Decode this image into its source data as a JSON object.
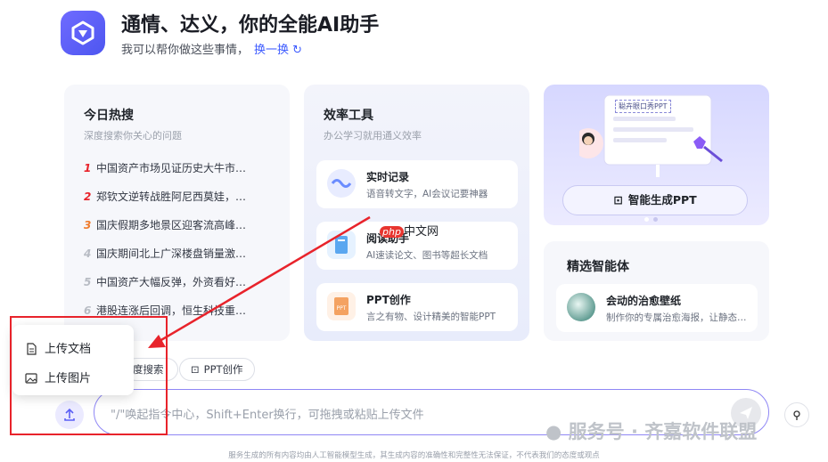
{
  "header": {
    "title": "通情、达义，你的全能AI助手",
    "subtitle": "我可以帮你做这些事情，",
    "refresh_label": "换一换",
    "refresh_icon": "refresh-icon"
  },
  "hot": {
    "title": "今日热搜",
    "subtitle": "深度搜索你关心的问题",
    "items": [
      {
        "num": "1",
        "label": "中国资产市场见证历史大牛市…",
        "color": "#e8232b"
      },
      {
        "num": "2",
        "label": "郑钦文逆转战胜阿尼西莫娃，…",
        "color": "#e8232b"
      },
      {
        "num": "3",
        "label": "国庆假期多地景区迎客流高峰…",
        "color": "#f07b2b"
      },
      {
        "num": "4",
        "label": "国庆期间北上广深楼盘销量激…",
        "color": "#b8bcc4"
      },
      {
        "num": "5",
        "label": "中国资产大幅反弹，外资看好…",
        "color": "#b8bcc4"
      },
      {
        "num": "6",
        "label": "港股连涨后回调，恒生科技重…",
        "color": "#b8bcc4"
      }
    ]
  },
  "tools": {
    "title": "效率工具",
    "subtitle": "办公学习就用通义效率",
    "items": [
      {
        "name": "实时记录",
        "desc": "语音转文字，AI会议记要神器"
      },
      {
        "name": "阅读助手",
        "desc": "AI速读论文、图书等超长文档"
      },
      {
        "name": "PPT创作",
        "desc": "言之有物、设计精美的智能PPT"
      }
    ]
  },
  "ppt_banner": {
    "board_label": "聪卉眼口秀PPT",
    "button_label": "智能生成PPT",
    "button_icon": "presentation-icon"
  },
  "agents": {
    "title": "精选智能体",
    "item": {
      "name": "会动的治愈壁纸",
      "desc": "制作你的专属治愈海报，让静态…"
    }
  },
  "chips": [
    {
      "label": "度搜索",
      "icon": ""
    },
    {
      "label": "PPT创作",
      "icon": "presentation-icon"
    }
  ],
  "input": {
    "placeholder": "\"/\"唤起指令中心，Shift+Enter换行，可拖拽或粘贴上传文件"
  },
  "upload_menu": {
    "items": [
      {
        "label": "上传文档",
        "icon": "document-icon"
      },
      {
        "label": "上传图片",
        "icon": "image-icon"
      }
    ]
  },
  "overlay": {
    "php_logo_p": "php",
    "php_logo_text": "中文网",
    "watermark": "服务号 · 齐嘉软件联盟",
    "footer": "服务生成的所有内容均由人工智能模型生成，其生成内容的准确性和完整性无法保证，不代表我们的态度或观点"
  },
  "colors": {
    "accent": "#3d5bff",
    "brand": "#5b5ff5",
    "highlight_box": "#e8232b"
  }
}
